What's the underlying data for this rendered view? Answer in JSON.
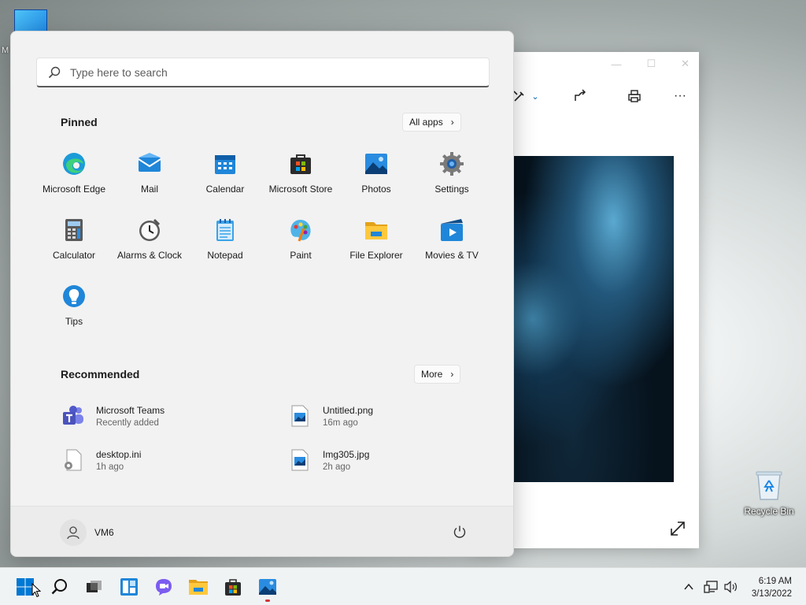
{
  "desktop": {
    "top_icon_label": "M",
    "recycle_bin_label": "Recycle Bin"
  },
  "photos_window": {
    "toolbar": [
      "edit-icon",
      "share-icon",
      "print-icon",
      "more-icon"
    ],
    "more_glyph": "···"
  },
  "start_menu": {
    "search": {
      "placeholder": "Type here to search"
    },
    "pinned": {
      "title": "Pinned",
      "all_apps_label": "All apps",
      "apps": [
        {
          "label": "Microsoft Edge",
          "icon": "edge-icon"
        },
        {
          "label": "Mail",
          "icon": "mail-icon"
        },
        {
          "label": "Calendar",
          "icon": "calendar-icon"
        },
        {
          "label": "Microsoft Store",
          "icon": "store-icon"
        },
        {
          "label": "Photos",
          "icon": "photos-icon"
        },
        {
          "label": "Settings",
          "icon": "settings-icon"
        },
        {
          "label": "Calculator",
          "icon": "calculator-icon"
        },
        {
          "label": "Alarms & Clock",
          "icon": "alarm-clock-icon"
        },
        {
          "label": "Notepad",
          "icon": "notepad-icon"
        },
        {
          "label": "Paint",
          "icon": "paint-icon"
        },
        {
          "label": "File Explorer",
          "icon": "file-explorer-icon"
        },
        {
          "label": "Movies & TV",
          "icon": "movies-tv-icon"
        },
        {
          "label": "Tips",
          "icon": "tips-icon"
        }
      ]
    },
    "recommended": {
      "title": "Recommended",
      "more_label": "More",
      "items": [
        {
          "name": "Microsoft Teams",
          "sub": "Recently added",
          "icon": "teams-icon"
        },
        {
          "name": "Untitled.png",
          "sub": "16m ago",
          "icon": "image-file-icon"
        },
        {
          "name": "desktop.ini",
          "sub": "1h ago",
          "icon": "settings-file-icon"
        },
        {
          "name": "Img305.jpg",
          "sub": "2h ago",
          "icon": "image-file-icon"
        }
      ]
    },
    "user": {
      "name": "VM6"
    }
  },
  "taskbar": {
    "clock": {
      "time": "6:19 AM",
      "date": "3/13/2022"
    }
  },
  "colors": {
    "accent": "#0067c0",
    "running_indicator": "#d13438"
  }
}
